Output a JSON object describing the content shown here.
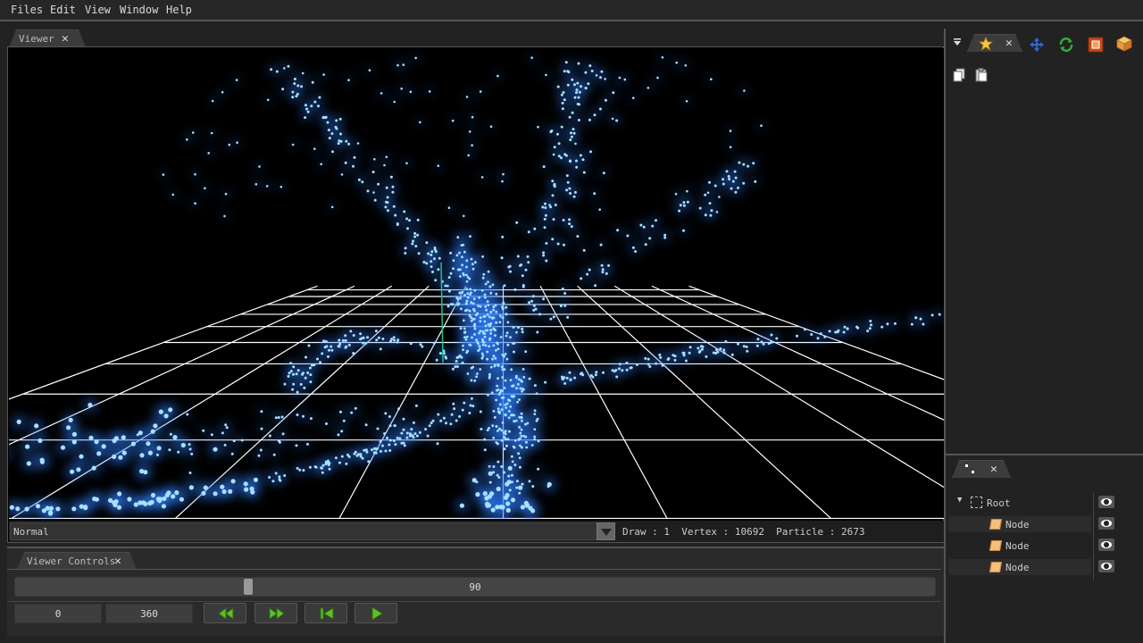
{
  "menu": [
    "Files",
    "Edit",
    "View",
    "Window",
    "Help"
  ],
  "viewer_tab": {
    "label": "Viewer",
    "close": "✕"
  },
  "viewer": {
    "mode": "Normal",
    "stats": "Draw : 1  Vertex : 10692  Particle : 2673"
  },
  "controls_tab": {
    "label": "Viewer Controls",
    "close": "✕"
  },
  "controls": {
    "frame_value": "90",
    "frame_fraction": 0.25,
    "start": "0",
    "end": "360"
  },
  "right_tabs": {
    "close": "✕"
  },
  "scene_tab": {
    "close": "✕"
  },
  "tree": {
    "root": "Root",
    "nodes": [
      "Node",
      "Node",
      "Node"
    ]
  },
  "colors": {
    "accent_green": "#6fc23a",
    "node_orange": "#f4c07a",
    "particle_blue": "#3a8cff"
  }
}
